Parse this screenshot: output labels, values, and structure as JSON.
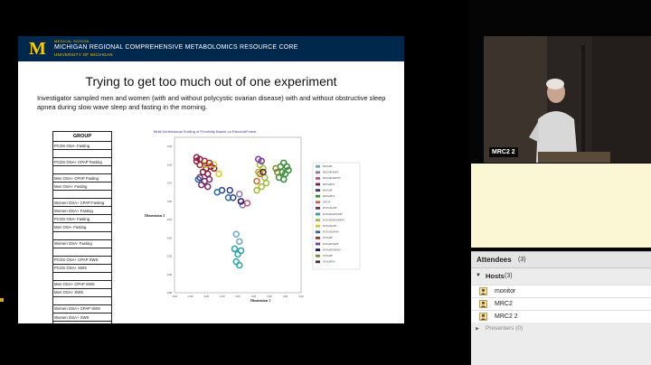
{
  "slide": {
    "header": {
      "logo": "M",
      "line1": "MEDICAL SCHOOL",
      "line2": "MICHIGAN REGIONAL COMPREHENSIVE METABOLOMICS RESOURCE CORE",
      "line3": "UNIVERSITY OF MICHIGAN"
    },
    "title": "Trying to get too much out of one experiment",
    "body": "Investigator sampled men and women (with and without polycystic ovarian disease) with and without obstructive sleep apnea during slow wave sleep and fasting in the morning.",
    "group_table": {
      "header": "GROUP",
      "rows": [
        "PCOS OSA- Fasting",
        "",
        "PCOS OSA+ CPAP Fasting",
        "",
        "Men OSA+ CPAP Fasting",
        "Men OSA+ Fasting",
        "",
        "Women OSA+ CPAP Fasting",
        "Women OSA+ Fasting",
        "PCOS OSA- Fasting",
        "Men OSA- Fasting",
        "",
        "Women OSA- Fasting",
        "",
        "PCOS OSA+ CPAP SWS",
        "PCOS OSA+ SWS",
        "",
        "Men OSA+ CPAP SWS",
        "Men OSA+ SWS",
        "",
        "Women OSA+ CPAP SWS",
        "Women OSA+ SWS",
        "PCOS OSA- SWS",
        "Men OSA- SWS"
      ]
    }
  },
  "chart_data": {
    "type": "scatter",
    "title": "Multi Dimensional Scaling of Proximity Based on RandomForest",
    "xlabel": "Dimension 1",
    "ylabel": "Dimension 2",
    "xlim": [
      -0.4,
      0.4
    ],
    "ylim": [
      -0.5,
      0.35
    ],
    "xticks": [
      "-0.40",
      "-0.30",
      "-0.20",
      "-0.10",
      "0.00",
      "0.10",
      "0.20",
      "0.30",
      "0.40"
    ],
    "yticks": [
      "0.30",
      "0.20",
      "0.10",
      "0.00",
      "-0.10",
      "-0.20",
      "-0.30",
      "-0.40",
      "-0.50"
    ],
    "legend_position": "right",
    "series": [
      {
        "name": "WOSAPF",
        "color": "#6aa6c8",
        "points": [
          [
            -0.01,
            -0.18
          ],
          [
            0.01,
            -0.22
          ]
        ]
      },
      {
        "name": "MOSAPCPAPF",
        "color": "#8a7aa8",
        "points": [
          [
            0.01,
            0.04
          ],
          [
            0.03,
            -0.02
          ]
        ]
      },
      {
        "name": "MOSAPCPAPF",
        "color": "#c9507a",
        "points": [
          [
            0.06,
            -0.01
          ]
        ]
      },
      {
        "name": "MOSAPCPAPWS",
        "color": "#8b1a3a",
        "points": [
          [
            -0.26,
            0.24
          ],
          [
            -0.24,
            0.23
          ],
          [
            -0.26,
            0.22
          ],
          [
            -0.2,
            0.18
          ],
          [
            -0.22,
            0.16
          ],
          [
            -0.17,
            0.19
          ],
          [
            -0.19,
            0.15
          ],
          [
            -0.15,
            0.18
          ]
        ]
      },
      {
        "name": "MOSAPF",
        "color": "#2d3f8f",
        "points": [
          [
            -0.1,
            0.06
          ],
          [
            -0.05,
            0.06
          ],
          [
            -0.03,
            0.02
          ]
        ]
      },
      {
        "name": "MOSAPWS",
        "color": "#3a8c3a",
        "points": [
          [
            0.27,
            0.19
          ],
          [
            0.29,
            0.21
          ],
          [
            0.31,
            0.19
          ],
          [
            0.28,
            0.16
          ],
          [
            0.3,
            0.15
          ],
          [
            0.32,
            0.17
          ],
          [
            0.26,
            0.13
          ],
          [
            0.29,
            0.12
          ]
        ]
      },
      {
        "name": "OPCSF",
        "color": "#c86a2a",
        "points": [
          [
            0.14,
            0.15
          ],
          [
            0.12,
            0.11
          ]
        ]
      },
      {
        "name": "PCOSOSANF",
        "color": "#7a2b6a",
        "points": [
          [
            -0.24,
            0.13
          ],
          [
            -0.21,
            0.11
          ],
          [
            -0.18,
            0.12
          ],
          [
            -0.23,
            0.09
          ],
          [
            -0.19,
            0.08
          ]
        ]
      },
      {
        "name": "PCOSOSAPCPAPF",
        "color": "#2aa3a8",
        "points": [
          [
            -0.02,
            -0.26
          ],
          [
            0.0,
            -0.29
          ],
          [
            0.02,
            -0.27
          ],
          [
            -0.01,
            -0.33
          ],
          [
            0.01,
            -0.35
          ]
        ]
      },
      {
        "name": "PCOSOSAPCPAPWS",
        "color": "#9fbf3a",
        "points": [
          [
            0.14,
            0.2
          ],
          [
            0.16,
            0.18
          ],
          [
            0.13,
            0.16
          ],
          [
            0.17,
            0.13
          ],
          [
            0.15,
            0.08
          ],
          [
            0.12,
            0.06
          ],
          [
            0.18,
            0.1
          ]
        ]
      },
      {
        "name": "WOSAPF",
        "color": "#d8c820",
        "points": [
          [
            -0.2,
            0.2
          ],
          [
            -0.15,
            0.2
          ],
          [
            -0.12,
            0.15
          ]
        ]
      },
      {
        "name": "WOSAPWS",
        "color": "#2a6aa8",
        "points": [
          [
            -0.25,
            0.12
          ],
          [
            -0.13,
            0.05
          ],
          [
            -0.06,
            0.02
          ]
        ]
      },
      {
        "name": "PCOSOSAPWS",
        "color": "#a03030",
        "points": [
          [
            -0.24,
            0.2
          ],
          [
            -0.18,
            0.21
          ],
          [
            -0.21,
            0.22
          ]
        ]
      },
      {
        "name": "WOSAPCPAPF",
        "color": "#7a3aa8",
        "points": [
          [
            0.15,
            0.22
          ],
          [
            0.13,
            0.23
          ]
        ]
      },
      {
        "name": "WOSAPCPAPWS",
        "color": "#1a1a6a",
        "points": [
          [
            0.02,
            0.0
          ]
        ]
      },
      {
        "name": "WOSAPCPAPWS",
        "color": "#7a8a2a",
        "points": [
          [
            0.25,
            0.16
          ],
          [
            0.24,
            0.18
          ]
        ]
      },
      {
        "name": "WOSAPWS",
        "color": "#5a2a2a",
        "points": [
          [
            0.16,
            0.16
          ]
        ]
      }
    ],
    "legend_labels": [
      "MOSAPF",
      "MOSAPCPAPF",
      "MOSAPCPAPWS",
      "MOSAPWS",
      "MOSAPF",
      "MOSAPWS",
      "OPCSF",
      "PCOSOSANF",
      "PCOSOSAPCPAPF",
      "PCOSOSAPCPAPWS",
      "PCOSOSAPF",
      "PCOSOSAPWS",
      "WOSAPF",
      "WOSAPCPAPF",
      "WOSAPCPAPWS",
      "WOSAPF",
      "WOSAPWS"
    ],
    "legend_colors": [
      "#6aa6c8",
      "#8a7aa8",
      "#c9507a",
      "#8b1a3a",
      "#2d3f8f",
      "#3a8c3a",
      "#c86a2a",
      "#7a2b6a",
      "#2aa3a8",
      "#9fbf3a",
      "#d8c820",
      "#2a6aa8",
      "#a03030",
      "#7a3aa8",
      "#1a1a6a",
      "#7a8a2a",
      "#5a2a2a"
    ]
  },
  "video": {
    "label": "MRC2 2",
    "colors": {
      "background": "#2a2522",
      "wall": "#3b332c",
      "shirt": "#d8d8d8"
    }
  },
  "attendees": {
    "title": "Attendees",
    "count": "(3)",
    "hosts": {
      "label": "Hosts",
      "count": "(3)",
      "items": [
        "monitor",
        "MRC2",
        "MRC2 2"
      ]
    },
    "presenters_label": "Presenters (0)"
  },
  "colors": {
    "header_navy": "#00274c",
    "maize": "#ffcb05",
    "strip": "#fbf7d5"
  }
}
